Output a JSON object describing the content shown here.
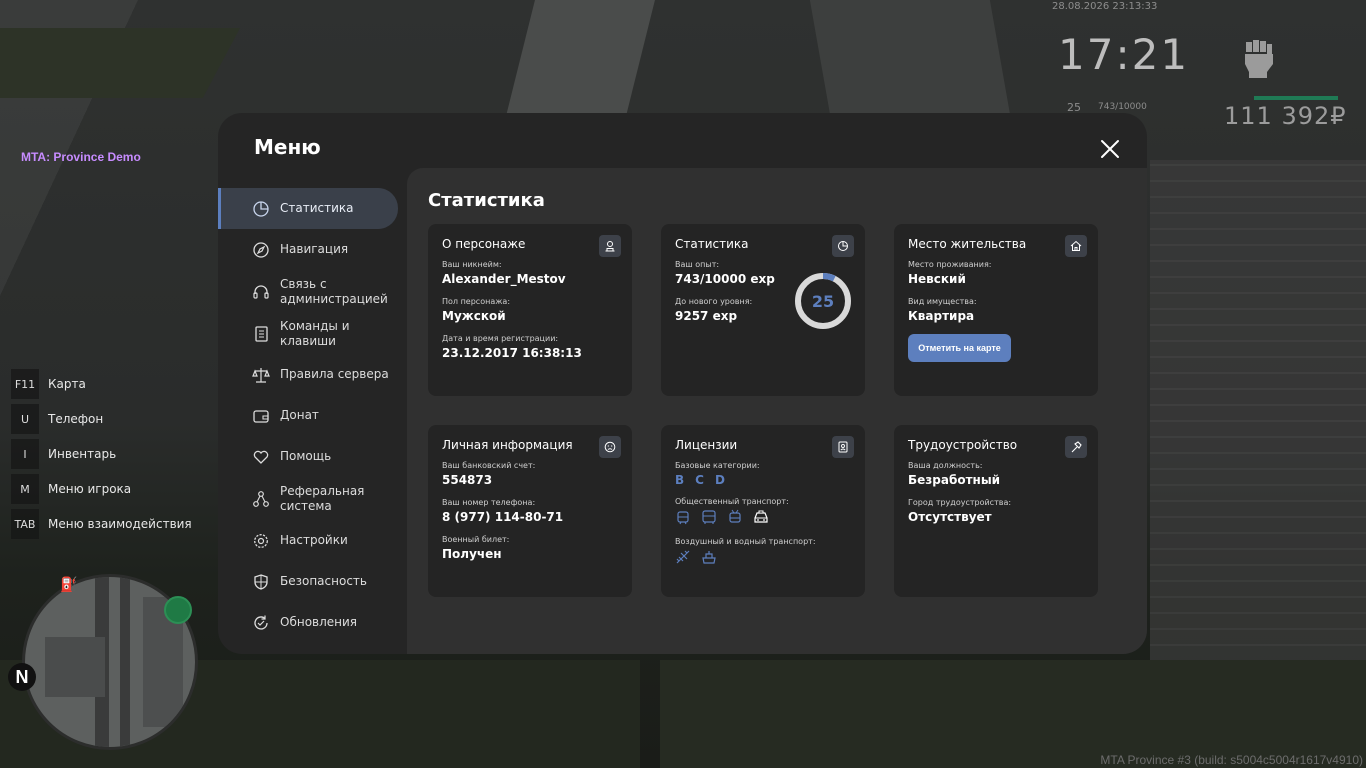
{
  "hud": {
    "datetime": "28.08.2026 23:13:33",
    "time": "17:21",
    "level": "25",
    "exp": "743/10000",
    "money": "111 392₽"
  },
  "server_name": "MTA: Province Demo",
  "build": "MTA Province #3 (build: s5004c5004r1617v4910)",
  "hotkeys": [
    {
      "key": "F11",
      "label": "Карта"
    },
    {
      "key": "U",
      "label": "Телефон"
    },
    {
      "key": "I",
      "label": "Инвентарь"
    },
    {
      "key": "M",
      "label": "Меню игрока"
    },
    {
      "key": "TAB",
      "label": "Меню взаимодействия"
    }
  ],
  "minimap": {
    "north": "N"
  },
  "menu": {
    "title": "Меню",
    "nav": [
      {
        "label": "Статистика",
        "icon": "pie-chart-icon",
        "active": true
      },
      {
        "label": "Навигация",
        "icon": "compass-icon"
      },
      {
        "label": "Связь с администрацией",
        "icon": "headset-icon"
      },
      {
        "label": "Команды и клавиши",
        "icon": "document-icon"
      },
      {
        "label": "Правила сервера",
        "icon": "scales-icon"
      },
      {
        "label": "Донат",
        "icon": "wallet-icon"
      },
      {
        "label": "Помощь",
        "icon": "heart-icon"
      },
      {
        "label": "Реферальная система",
        "icon": "network-icon"
      },
      {
        "label": "Настройки",
        "icon": "gear-icon"
      },
      {
        "label": "Безопасность",
        "icon": "shield-icon"
      },
      {
        "label": "Обновления",
        "icon": "refresh-icon"
      }
    ]
  },
  "stats": {
    "title": "Статистика",
    "character": {
      "title": "О персонаже",
      "nickname_label": "Ваш никнейм:",
      "nickname": "Alexander_Mestov",
      "gender_label": "Пол персонажа:",
      "gender": "Мужской",
      "reg_label": "Дата и время регистрации:",
      "reg": "23.12.2017 16:38:13"
    },
    "statistics": {
      "title": "Статистика",
      "exp_label": "Ваш опыт:",
      "exp": "743/10000 exp",
      "next_label": "До нового уровня:",
      "next": "9257 exp",
      "level": "25",
      "progress": 0.0743
    },
    "residence": {
      "title": "Место жительства",
      "place_label": "Место проживания:",
      "place": "Невский",
      "type_label": "Вид имущества:",
      "type": "Квартира",
      "button": "Отметить на карте"
    },
    "personal": {
      "title": "Личная информация",
      "bank_label": "Ваш банковский счет:",
      "bank": "554873",
      "phone_label": "Ваш номер телефона:",
      "phone": "8 (977) 114-80-71",
      "military_label": "Военный билет:",
      "military": "Получен"
    },
    "licenses": {
      "title": "Лицензии",
      "base_label": "Базовые категории:",
      "categories": [
        "B",
        "C",
        "D"
      ],
      "public_label": "Общественный транспорт:",
      "air_label": "Воздушный и водный транспорт:"
    },
    "employment": {
      "title": "Трудоустройство",
      "position_label": "Ваша должность:",
      "position": "Безработный",
      "city_label": "Город трудоустройства:",
      "city": "Отсутствует"
    }
  },
  "colors": {
    "accent": "#5d7fbe",
    "panel": "#252525",
    "card": "#242424",
    "content": "#303030"
  }
}
